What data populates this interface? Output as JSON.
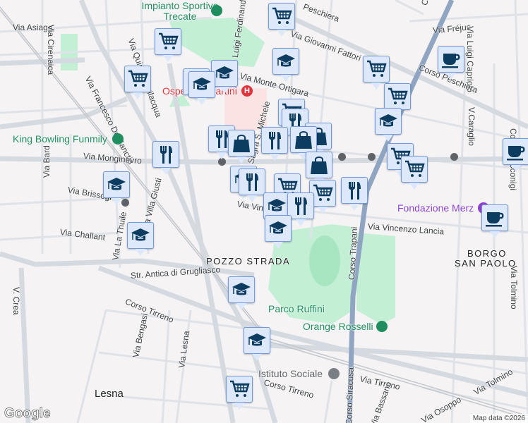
{
  "streets": {
    "via_asiago": "Via Asiago",
    "via_cirenaica": "Via Cirenaica",
    "via_de_sanctis": "Via Francesco De Sanctis",
    "via_quinto": "Via Quinto Bevilacqua",
    "via_monginevro": "Via Monginevro",
    "via_bard": "Via Bard",
    "via_brissogne": "Via Brissogne",
    "via_villa_giusti": "Via Villa Giusti",
    "via_challant": "Via Challant",
    "via_la_thuile": "Via La Thuile",
    "str_grugliasco": "Str. Antica di Grugliasco",
    "corso_tirreno": "Corso Tirreno",
    "via_bengasi": "Via Bengasi",
    "via_lesna": "Via Lesna",
    "v_crea": "V. Crea",
    "corso_peschiera_top": "Peschiera",
    "via_giovanni_fattori": "Via Giovanni Fattori",
    "via_monte_ortigara": "Via Monte Ortigara",
    "via_frejus": "Via Fréjus",
    "via_luigi_capriolo": "Via Luigi Capriolo",
    "corso_peschiera": "Corso Peschiera",
    "v_caraglio": "V.Caraglio",
    "corso_trapani": "Corso Trapani",
    "corso_siracusa": "Corso Siracusa",
    "via_vincenzo_lancia": "Via Vincenzo Lancia",
    "via_tolmino": "Via Tolmino",
    "via_tirreno": "Via Tirreno",
    "via_bassano": "Via Bassano",
    "via_osoppo": "Via Osoppo",
    "via_vinc": "Via Vinc",
    "via_luigi_ferdinando": "Via Luigi Ferdinando Ma",
    "via_sagra": "Sagra S. Michele",
    "corso_racconigi": "Corso Racconigi"
  },
  "places": {
    "impianto": "Impianto Sportivo Trecate",
    "ospedale": "Ospedale Martini",
    "king_bowling": "King Bowling Funmily",
    "fondazione_merz": "Fondazione Merz",
    "parco_ruffini": "Parco Ruffini",
    "orange_rosselli": "Orange Rosselli",
    "istituto_sociale": "Istituto Sociale"
  },
  "areas": {
    "pozzo_strada": "POZZO STRADA",
    "borgo": "BORGO",
    "san_paolo": "SAN PAOLO",
    "lesna": "Lesna"
  },
  "footer": {
    "logo": "Google",
    "attribution": "Map data ©2026"
  },
  "colors": {
    "marker_bg": "#dde8fb",
    "marker_border": "#7199dc",
    "icon": "#0d3c61",
    "park": "#c3efd5",
    "poi": "#1e8e5e"
  }
}
